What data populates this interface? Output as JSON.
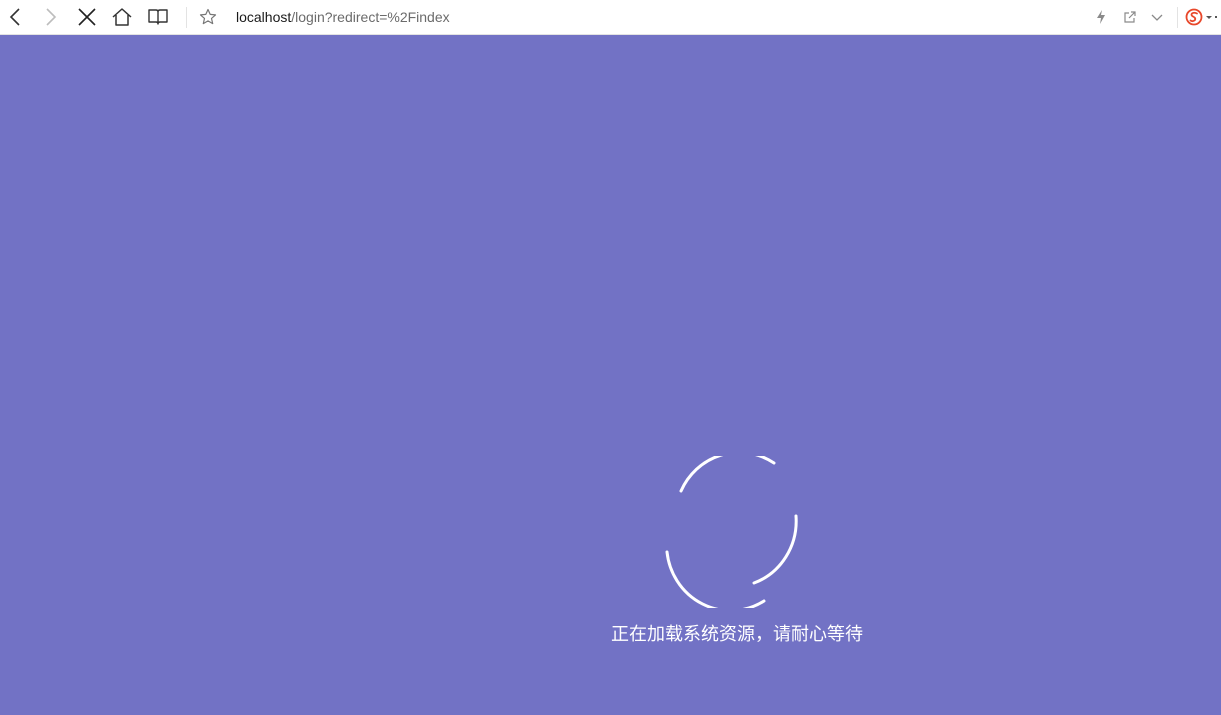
{
  "browser": {
    "url_host": "localhost",
    "url_path": "/login?redirect=%2Findex",
    "icons": {
      "back": "chevron-left-icon",
      "forward": "chevron-right-icon",
      "stop": "close-icon",
      "home": "home-icon",
      "reading_mode": "book-icon",
      "bookmark": "star-icon",
      "flash": "lightning-icon",
      "share": "share-icon",
      "menu": "chevron-down-icon",
      "extension": "sogou-icon"
    }
  },
  "page": {
    "background_color": "#7272c5",
    "loading_text": "正在加载系统资源，请耐心等待"
  },
  "colors": {
    "accent": "#7272c5",
    "spinner": "#ffffff",
    "extension": "#e8472a"
  }
}
